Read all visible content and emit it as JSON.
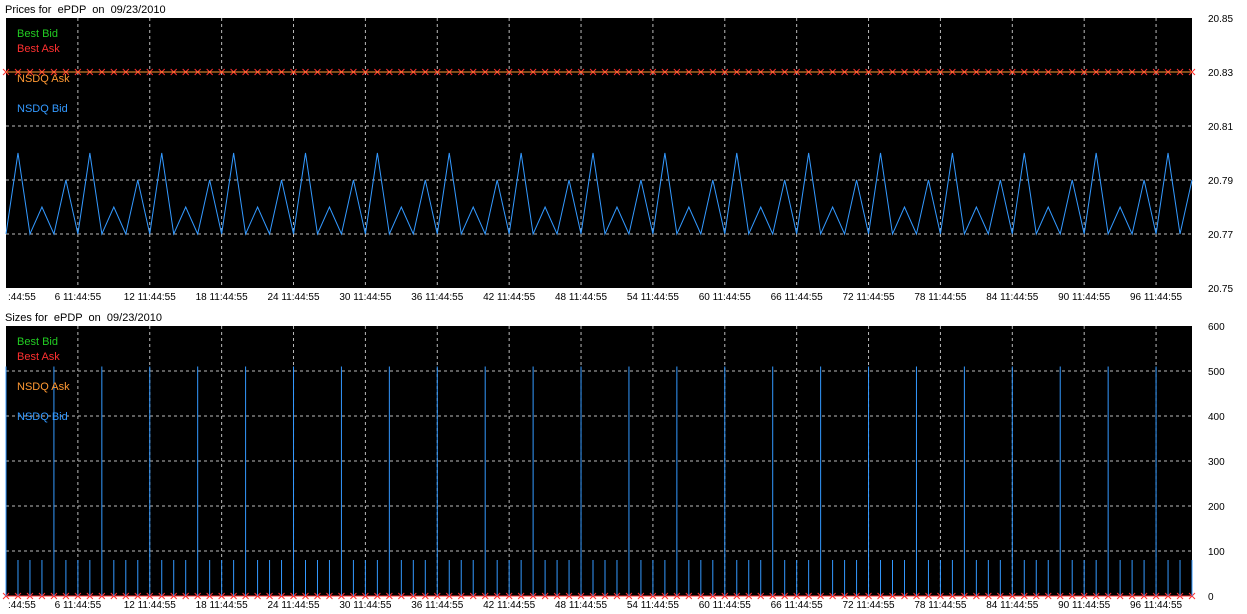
{
  "colors": {
    "best_bid": "#22cc22",
    "best_ask": "#ff3030",
    "nsdq_ask": "#ff9933",
    "nsdq_bid": "#3399ff",
    "grid": "#bbbbbb",
    "background": "#000000"
  },
  "chart_data": [
    {
      "type": "line",
      "title": "Prices for  ePDP  on  09/23/2010",
      "x_tick_labels": [
        ":44:55",
        "6 11:44:55",
        "12 11:44:55",
        "18 11:44:55",
        "24 11:44:55",
        "30 11:44:55",
        "36 11:44:55",
        "42 11:44:55",
        "48 11:44:55",
        "54 11:44:55",
        "60 11:44:55",
        "66 11:44:55",
        "72 11:44:55",
        "78 11:44:55",
        "84 11:44:55",
        "90 11:44:55",
        "96 11:44:55"
      ],
      "xlim": [
        0,
        99
      ],
      "ylim": [
        20.75,
        20.85
      ],
      "y_ticks": [
        20.75,
        20.77,
        20.79,
        20.81,
        20.83,
        20.85
      ],
      "y_tick_labels": [
        "20.75",
        "20.77",
        "20.79",
        "20.81",
        "20.83",
        "20.85"
      ],
      "grid": true,
      "legend_position": "top-left",
      "legend": [
        "Best Bid",
        "Best Ask",
        "NSDQ Ask",
        "NSDQ Bid"
      ],
      "series": [
        {
          "name": "Best Ask",
          "color": "#ff3030",
          "marker": "x",
          "values": [
            20.83,
            20.83,
            20.83,
            20.83,
            20.83,
            20.83,
            20.83,
            20.83,
            20.83,
            20.83,
            20.83,
            20.83,
            20.83,
            20.83,
            20.83,
            20.83,
            20.83,
            20.83,
            20.83,
            20.83,
            20.83,
            20.83,
            20.83,
            20.83,
            20.83,
            20.83,
            20.83,
            20.83,
            20.83,
            20.83,
            20.83,
            20.83,
            20.83,
            20.83,
            20.83,
            20.83,
            20.83,
            20.83,
            20.83,
            20.83,
            20.83,
            20.83,
            20.83,
            20.83,
            20.83,
            20.83,
            20.83,
            20.83,
            20.83,
            20.83,
            20.83,
            20.83,
            20.83,
            20.83,
            20.83,
            20.83,
            20.83,
            20.83,
            20.83,
            20.83,
            20.83,
            20.83,
            20.83,
            20.83,
            20.83,
            20.83,
            20.83,
            20.83,
            20.83,
            20.83,
            20.83,
            20.83,
            20.83,
            20.83,
            20.83,
            20.83,
            20.83,
            20.83,
            20.83,
            20.83,
            20.83,
            20.83,
            20.83,
            20.83,
            20.83,
            20.83,
            20.83,
            20.83,
            20.83,
            20.83,
            20.83,
            20.83,
            20.83,
            20.83,
            20.83,
            20.83,
            20.83,
            20.83,
            20.83,
            20.83
          ]
        },
        {
          "name": "NSDQ Ask",
          "color": "#ff9933",
          "values": [
            20.83,
            20.83,
            20.83,
            20.83,
            20.83,
            20.83,
            20.83,
            20.83,
            20.83,
            20.83,
            20.83,
            20.83,
            20.83,
            20.83,
            20.83,
            20.83,
            20.83,
            20.83,
            20.83,
            20.83,
            20.83,
            20.83,
            20.83,
            20.83,
            20.83,
            20.83,
            20.83,
            20.83,
            20.83,
            20.83,
            20.83,
            20.83,
            20.83,
            20.83,
            20.83,
            20.83,
            20.83,
            20.83,
            20.83,
            20.83,
            20.83,
            20.83,
            20.83,
            20.83,
            20.83,
            20.83,
            20.83,
            20.83,
            20.83,
            20.83,
            20.83,
            20.83,
            20.83,
            20.83,
            20.83,
            20.83,
            20.83,
            20.83,
            20.83,
            20.83,
            20.83,
            20.83,
            20.83,
            20.83,
            20.83,
            20.83,
            20.83,
            20.83,
            20.83,
            20.83,
            20.83,
            20.83,
            20.83,
            20.83,
            20.83,
            20.83,
            20.83,
            20.83,
            20.83,
            20.83,
            20.83,
            20.83,
            20.83,
            20.83,
            20.83,
            20.83,
            20.83,
            20.83,
            20.83,
            20.83,
            20.83,
            20.83,
            20.83,
            20.83,
            20.83,
            20.83,
            20.83,
            20.83,
            20.83,
            20.83
          ]
        },
        {
          "name": "NSDQ Bid",
          "color": "#3399ff",
          "values": [
            20.77,
            20.8,
            20.77,
            20.78,
            20.77,
            20.79,
            20.77,
            20.8,
            20.77,
            20.78,
            20.77,
            20.79,
            20.77,
            20.8,
            20.77,
            20.78,
            20.77,
            20.79,
            20.77,
            20.8,
            20.77,
            20.78,
            20.77,
            20.79,
            20.77,
            20.8,
            20.77,
            20.78,
            20.77,
            20.79,
            20.77,
            20.8,
            20.77,
            20.78,
            20.77,
            20.79,
            20.77,
            20.8,
            20.77,
            20.78,
            20.77,
            20.79,
            20.77,
            20.8,
            20.77,
            20.78,
            20.77,
            20.79,
            20.77,
            20.8,
            20.77,
            20.78,
            20.77,
            20.79,
            20.77,
            20.8,
            20.77,
            20.78,
            20.77,
            20.79,
            20.77,
            20.8,
            20.77,
            20.78,
            20.77,
            20.79,
            20.77,
            20.8,
            20.77,
            20.78,
            20.77,
            20.79,
            20.77,
            20.8,
            20.77,
            20.78,
            20.77,
            20.79,
            20.77,
            20.8,
            20.77,
            20.78,
            20.77,
            20.79,
            20.77,
            20.8,
            20.77,
            20.78,
            20.77,
            20.79,
            20.77,
            20.8,
            20.77,
            20.78,
            20.77,
            20.79,
            20.77,
            20.8,
            20.77,
            20.79
          ]
        }
      ]
    },
    {
      "type": "bar",
      "title": "Sizes for  ePDP  on  09/23/2010",
      "x_tick_labels": [
        ":44:55",
        "6 11:44:55",
        "12 11:44:55",
        "18 11:44:55",
        "24 11:44:55",
        "30 11:44:55",
        "36 11:44:55",
        "42 11:44:55",
        "48 11:44:55",
        "54 11:44:55",
        "60 11:44:55",
        "66 11:44:55",
        "72 11:44:55",
        "78 11:44:55",
        "84 11:44:55",
        "90 11:44:55",
        "96 11:44:55"
      ],
      "xlim": [
        0,
        99
      ],
      "ylim": [
        0,
        600
      ],
      "y_ticks": [
        0,
        100,
        200,
        300,
        400,
        500,
        600
      ],
      "y_tick_labels": [
        "0",
        "100",
        "200",
        "300",
        "400",
        "500",
        "600"
      ],
      "grid": true,
      "legend_position": "top-left",
      "legend": [
        "Best Bid",
        "Best Ask",
        "NSDQ Ask",
        "NSDQ Bid"
      ],
      "series": [
        {
          "name": "Best Ask",
          "color": "#ff3030",
          "marker": "x",
          "values": [
            0,
            0,
            0,
            0,
            0,
            0,
            0,
            0,
            0,
            0,
            0,
            0,
            0,
            0,
            0,
            0,
            0,
            0,
            0,
            0,
            0,
            0,
            0,
            0,
            0,
            0,
            0,
            0,
            0,
            0,
            0,
            0,
            0,
            0,
            0,
            0,
            0,
            0,
            0,
            0,
            0,
            0,
            0,
            0,
            0,
            0,
            0,
            0,
            0,
            0,
            0,
            0,
            0,
            0,
            0,
            0,
            0,
            0,
            0,
            0,
            0,
            0,
            0,
            0,
            0,
            0,
            0,
            0,
            0,
            0,
            0,
            0,
            0,
            0,
            0,
            0,
            0,
            0,
            0,
            0,
            0,
            0,
            0,
            0,
            0,
            0,
            0,
            0,
            0,
            0,
            0,
            0,
            0,
            0,
            0,
            0,
            0,
            0,
            0,
            0
          ]
        },
        {
          "name": "NSDQ Bid",
          "color": "#3399ff",
          "values": [
            510,
            80,
            80,
            80,
            510,
            80,
            80,
            80,
            510,
            80,
            80,
            80,
            510,
            80,
            80,
            80,
            510,
            80,
            80,
            80,
            510,
            80,
            80,
            80,
            510,
            80,
            80,
            80,
            510,
            80,
            80,
            80,
            510,
            80,
            80,
            80,
            510,
            80,
            80,
            80,
            510,
            80,
            80,
            80,
            510,
            80,
            80,
            80,
            510,
            80,
            80,
            80,
            510,
            80,
            80,
            80,
            510,
            80,
            80,
            80,
            510,
            80,
            80,
            80,
            510,
            80,
            80,
            80,
            510,
            80,
            80,
            80,
            510,
            80,
            80,
            80,
            510,
            80,
            80,
            80,
            510,
            80,
            80,
            80,
            510,
            80,
            80,
            80,
            510,
            80,
            80,
            80,
            510,
            80,
            80,
            80,
            510,
            80,
            80,
            80
          ]
        }
      ]
    }
  ]
}
